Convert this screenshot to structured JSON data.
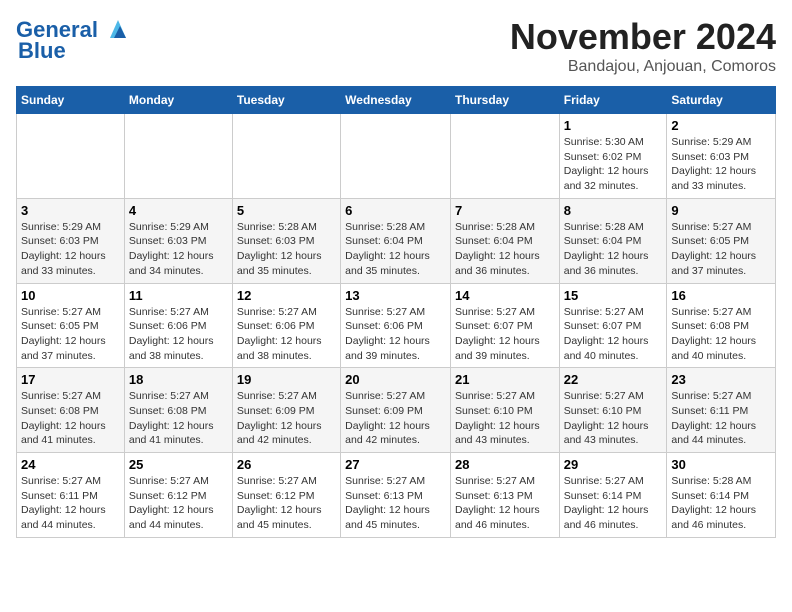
{
  "header": {
    "logo_line1": "General",
    "logo_line2": "Blue",
    "month": "November 2024",
    "location": "Bandajou, Anjouan, Comoros"
  },
  "days_of_week": [
    "Sunday",
    "Monday",
    "Tuesday",
    "Wednesday",
    "Thursday",
    "Friday",
    "Saturday"
  ],
  "weeks": [
    [
      {
        "day": "",
        "info": ""
      },
      {
        "day": "",
        "info": ""
      },
      {
        "day": "",
        "info": ""
      },
      {
        "day": "",
        "info": ""
      },
      {
        "day": "",
        "info": ""
      },
      {
        "day": "1",
        "info": "Sunrise: 5:30 AM\nSunset: 6:02 PM\nDaylight: 12 hours\nand 32 minutes."
      },
      {
        "day": "2",
        "info": "Sunrise: 5:29 AM\nSunset: 6:03 PM\nDaylight: 12 hours\nand 33 minutes."
      }
    ],
    [
      {
        "day": "3",
        "info": "Sunrise: 5:29 AM\nSunset: 6:03 PM\nDaylight: 12 hours\nand 33 minutes."
      },
      {
        "day": "4",
        "info": "Sunrise: 5:29 AM\nSunset: 6:03 PM\nDaylight: 12 hours\nand 34 minutes."
      },
      {
        "day": "5",
        "info": "Sunrise: 5:28 AM\nSunset: 6:03 PM\nDaylight: 12 hours\nand 35 minutes."
      },
      {
        "day": "6",
        "info": "Sunrise: 5:28 AM\nSunset: 6:04 PM\nDaylight: 12 hours\nand 35 minutes."
      },
      {
        "day": "7",
        "info": "Sunrise: 5:28 AM\nSunset: 6:04 PM\nDaylight: 12 hours\nand 36 minutes."
      },
      {
        "day": "8",
        "info": "Sunrise: 5:28 AM\nSunset: 6:04 PM\nDaylight: 12 hours\nand 36 minutes."
      },
      {
        "day": "9",
        "info": "Sunrise: 5:27 AM\nSunset: 6:05 PM\nDaylight: 12 hours\nand 37 minutes."
      }
    ],
    [
      {
        "day": "10",
        "info": "Sunrise: 5:27 AM\nSunset: 6:05 PM\nDaylight: 12 hours\nand 37 minutes."
      },
      {
        "day": "11",
        "info": "Sunrise: 5:27 AM\nSunset: 6:06 PM\nDaylight: 12 hours\nand 38 minutes."
      },
      {
        "day": "12",
        "info": "Sunrise: 5:27 AM\nSunset: 6:06 PM\nDaylight: 12 hours\nand 38 minutes."
      },
      {
        "day": "13",
        "info": "Sunrise: 5:27 AM\nSunset: 6:06 PM\nDaylight: 12 hours\nand 39 minutes."
      },
      {
        "day": "14",
        "info": "Sunrise: 5:27 AM\nSunset: 6:07 PM\nDaylight: 12 hours\nand 39 minutes."
      },
      {
        "day": "15",
        "info": "Sunrise: 5:27 AM\nSunset: 6:07 PM\nDaylight: 12 hours\nand 40 minutes."
      },
      {
        "day": "16",
        "info": "Sunrise: 5:27 AM\nSunset: 6:08 PM\nDaylight: 12 hours\nand 40 minutes."
      }
    ],
    [
      {
        "day": "17",
        "info": "Sunrise: 5:27 AM\nSunset: 6:08 PM\nDaylight: 12 hours\nand 41 minutes."
      },
      {
        "day": "18",
        "info": "Sunrise: 5:27 AM\nSunset: 6:08 PM\nDaylight: 12 hours\nand 41 minutes."
      },
      {
        "day": "19",
        "info": "Sunrise: 5:27 AM\nSunset: 6:09 PM\nDaylight: 12 hours\nand 42 minutes."
      },
      {
        "day": "20",
        "info": "Sunrise: 5:27 AM\nSunset: 6:09 PM\nDaylight: 12 hours\nand 42 minutes."
      },
      {
        "day": "21",
        "info": "Sunrise: 5:27 AM\nSunset: 6:10 PM\nDaylight: 12 hours\nand 43 minutes."
      },
      {
        "day": "22",
        "info": "Sunrise: 5:27 AM\nSunset: 6:10 PM\nDaylight: 12 hours\nand 43 minutes."
      },
      {
        "day": "23",
        "info": "Sunrise: 5:27 AM\nSunset: 6:11 PM\nDaylight: 12 hours\nand 44 minutes."
      }
    ],
    [
      {
        "day": "24",
        "info": "Sunrise: 5:27 AM\nSunset: 6:11 PM\nDaylight: 12 hours\nand 44 minutes."
      },
      {
        "day": "25",
        "info": "Sunrise: 5:27 AM\nSunset: 6:12 PM\nDaylight: 12 hours\nand 44 minutes."
      },
      {
        "day": "26",
        "info": "Sunrise: 5:27 AM\nSunset: 6:12 PM\nDaylight: 12 hours\nand 45 minutes."
      },
      {
        "day": "27",
        "info": "Sunrise: 5:27 AM\nSunset: 6:13 PM\nDaylight: 12 hours\nand 45 minutes."
      },
      {
        "day": "28",
        "info": "Sunrise: 5:27 AM\nSunset: 6:13 PM\nDaylight: 12 hours\nand 46 minutes."
      },
      {
        "day": "29",
        "info": "Sunrise: 5:27 AM\nSunset: 6:14 PM\nDaylight: 12 hours\nand 46 minutes."
      },
      {
        "day": "30",
        "info": "Sunrise: 5:28 AM\nSunset: 6:14 PM\nDaylight: 12 hours\nand 46 minutes."
      }
    ]
  ]
}
